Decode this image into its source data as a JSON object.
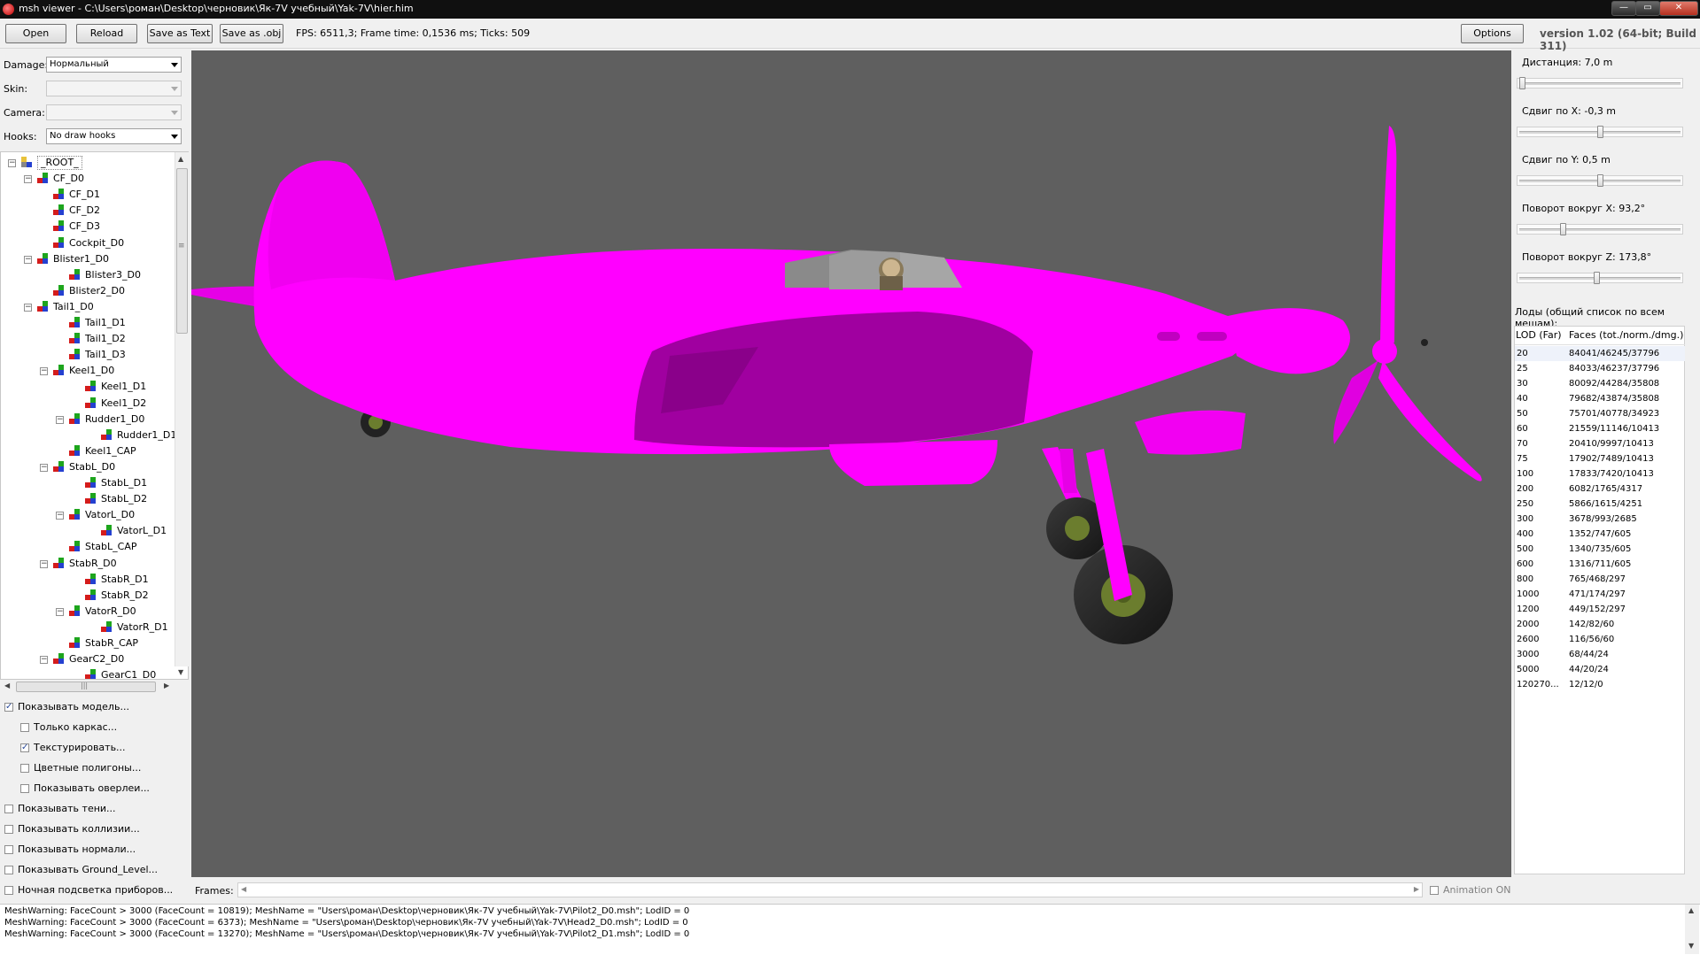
{
  "window": {
    "title": "msh viewer - C:\\Users\\роман\\Desktop\\черновик\\Як-7V учебный\\Yak-7V\\hier.him",
    "min_glyph": "—",
    "max_glyph": "▭",
    "close_glyph": "✕"
  },
  "toolbar": {
    "open_label": "Open",
    "reload_label": "Reload",
    "save_text_label": "Save as Text",
    "save_obj_label": "Save as .obj",
    "fps_text": "FPS: 6511,3; Frame time: 0,1536 ms; Ticks: 509",
    "options_label": "Options",
    "version": "version 1.02 (64-bit; Build 311)"
  },
  "left": {
    "damage_label": "Damage:",
    "damage_value": "Нормальный",
    "skin_label": "Skin:",
    "skin_value": "",
    "camera_label": "Camera:",
    "camera_value": "",
    "hooks_label": "Hooks:",
    "hooks_value": "No draw hooks",
    "tree": [
      {
        "label": "_ROOT_",
        "depth": 0,
        "expander": "-",
        "root": true
      },
      {
        "label": "CF_D0",
        "depth": 1,
        "expander": "-"
      },
      {
        "label": "CF_D1",
        "depth": 2,
        "expander": ""
      },
      {
        "label": "CF_D2",
        "depth": 2,
        "expander": ""
      },
      {
        "label": "CF_D3",
        "depth": 2,
        "expander": ""
      },
      {
        "label": "Cockpit_D0",
        "depth": 2,
        "expander": ""
      },
      {
        "label": "Blister1_D0",
        "depth": 1,
        "expander": "-"
      },
      {
        "label": "Blister3_D0",
        "depth": 3,
        "expander": ""
      },
      {
        "label": "Blister2_D0",
        "depth": 2,
        "expander": ""
      },
      {
        "label": "Tail1_D0",
        "depth": 1,
        "expander": "-"
      },
      {
        "label": "Tail1_D1",
        "depth": 3,
        "expander": ""
      },
      {
        "label": "Tail1_D2",
        "depth": 3,
        "expander": ""
      },
      {
        "label": "Tail1_D3",
        "depth": 3,
        "expander": ""
      },
      {
        "label": "Keel1_D0",
        "depth": 2,
        "expander": "-"
      },
      {
        "label": "Keel1_D1",
        "depth": 4,
        "expander": ""
      },
      {
        "label": "Keel1_D2",
        "depth": 4,
        "expander": ""
      },
      {
        "label": "Rudder1_D0",
        "depth": 3,
        "expander": "-"
      },
      {
        "label": "Rudder1_D1",
        "depth": 5,
        "expander": ""
      },
      {
        "label": "Keel1_CAP",
        "depth": 3,
        "expander": ""
      },
      {
        "label": "StabL_D0",
        "depth": 2,
        "expander": "-"
      },
      {
        "label": "StabL_D1",
        "depth": 4,
        "expander": ""
      },
      {
        "label": "StabL_D2",
        "depth": 4,
        "expander": ""
      },
      {
        "label": "VatorL_D0",
        "depth": 3,
        "expander": "-"
      },
      {
        "label": "VatorL_D1",
        "depth": 5,
        "expander": ""
      },
      {
        "label": "StabL_CAP",
        "depth": 3,
        "expander": ""
      },
      {
        "label": "StabR_D0",
        "depth": 2,
        "expander": "-"
      },
      {
        "label": "StabR_D1",
        "depth": 4,
        "expander": ""
      },
      {
        "label": "StabR_D2",
        "depth": 4,
        "expander": ""
      },
      {
        "label": "VatorR_D0",
        "depth": 3,
        "expander": "-"
      },
      {
        "label": "VatorR_D1",
        "depth": 5,
        "expander": ""
      },
      {
        "label": "StabR_CAP",
        "depth": 3,
        "expander": ""
      },
      {
        "label": "GearC2_D0",
        "depth": 2,
        "expander": "-"
      },
      {
        "label": "GearC1_D0",
        "depth": 4,
        "expander": ""
      }
    ],
    "scroll_grip": "≡",
    "hscroll_grip": "|||",
    "checkboxes": [
      {
        "label": "Показывать модель...",
        "checked": true,
        "indent": false
      },
      {
        "label": "Только каркас...",
        "checked": false,
        "indent": true
      },
      {
        "label": "Текстурировать...",
        "checked": true,
        "indent": true
      },
      {
        "label": "Цветные полигоны...",
        "checked": false,
        "indent": true
      },
      {
        "label": "Показывать оверлеи...",
        "checked": false,
        "indent": true
      },
      {
        "label": "Показывать тени...",
        "checked": false,
        "indent": false
      },
      {
        "label": "Показывать коллизии...",
        "checked": false,
        "indent": false
      },
      {
        "label": "Показывать нормали...",
        "checked": false,
        "indent": false
      },
      {
        "label": "Показывать Ground_Level...",
        "checked": false,
        "indent": false
      },
      {
        "label": "Ночная подсветка приборов...",
        "checked": false,
        "indent": false
      }
    ]
  },
  "viewport": {
    "background": "#5f5f5f",
    "model_color": "#ff00ff",
    "model_shade": "#a000a0"
  },
  "frames": {
    "label": "Frames:",
    "animation_label": "Animation ON",
    "animation_on": false
  },
  "right": {
    "sliders": [
      {
        "label": "Дистанция:  7,0 m",
        "fraction": 0.0
      },
      {
        "label": "Сдвиг по X:  -0,3 m",
        "fraction": 0.5
      },
      {
        "label": "Сдвиг по Y:  0,5 m",
        "fraction": 0.5
      },
      {
        "label": "Поворот вокруг X:  93,2°",
        "fraction": 0.26
      },
      {
        "label": "Поворот вокруг Z:  173,8°",
        "fraction": 0.48
      }
    ],
    "lods_title": "Лоды (общий список по всем мешам):",
    "lod_header_lod": "LOD (Far)",
    "lod_header_faces": "Faces (tot./norm./dmg.)",
    "lods": [
      {
        "lod": "20",
        "faces": "84041/46245/37796"
      },
      {
        "lod": "25",
        "faces": "84033/46237/37796"
      },
      {
        "lod": "30",
        "faces": "80092/44284/35808"
      },
      {
        "lod": "40",
        "faces": "79682/43874/35808"
      },
      {
        "lod": "50",
        "faces": "75701/40778/34923"
      },
      {
        "lod": "60",
        "faces": "21559/11146/10413"
      },
      {
        "lod": "70",
        "faces": "20410/9997/10413"
      },
      {
        "lod": "75",
        "faces": "17902/7489/10413"
      },
      {
        "lod": "100",
        "faces": "17833/7420/10413"
      },
      {
        "lod": "200",
        "faces": "6082/1765/4317"
      },
      {
        "lod": "250",
        "faces": "5866/1615/4251"
      },
      {
        "lod": "300",
        "faces": "3678/993/2685"
      },
      {
        "lod": "400",
        "faces": "1352/747/605"
      },
      {
        "lod": "500",
        "faces": "1340/735/605"
      },
      {
        "lod": "600",
        "faces": "1316/711/605"
      },
      {
        "lod": "800",
        "faces": "765/468/297"
      },
      {
        "lod": "1000",
        "faces": "471/174/297"
      },
      {
        "lod": "1200",
        "faces": "449/152/297"
      },
      {
        "lod": "2000",
        "faces": "142/82/60"
      },
      {
        "lod": "2600",
        "faces": "116/56/60"
      },
      {
        "lod": "3000",
        "faces": "68/44/24"
      },
      {
        "lod": "5000",
        "faces": "44/20/24"
      },
      {
        "lod": "120270...",
        "faces": "12/12/0"
      }
    ]
  },
  "log": [
    "MeshWarning: FaceCount > 3000 (FaceCount = 10819); MeshName = \"Users\\роман\\Desktop\\черновик\\Як-7V учебный\\Yak-7V\\Pilot2_D0.msh\"; LodID = 0",
    "MeshWarning: FaceCount > 3000 (FaceCount = 6373); MeshName = \"Users\\роман\\Desktop\\черновик\\Як-7V учебный\\Yak-7V\\Head2_D0.msh\"; LodID = 0",
    "MeshWarning: FaceCount > 3000 (FaceCount = 13270); MeshName = \"Users\\роман\\Desktop\\черновик\\Як-7V учебный\\Yak-7V\\Pilot2_D1.msh\"; LodID = 0"
  ]
}
